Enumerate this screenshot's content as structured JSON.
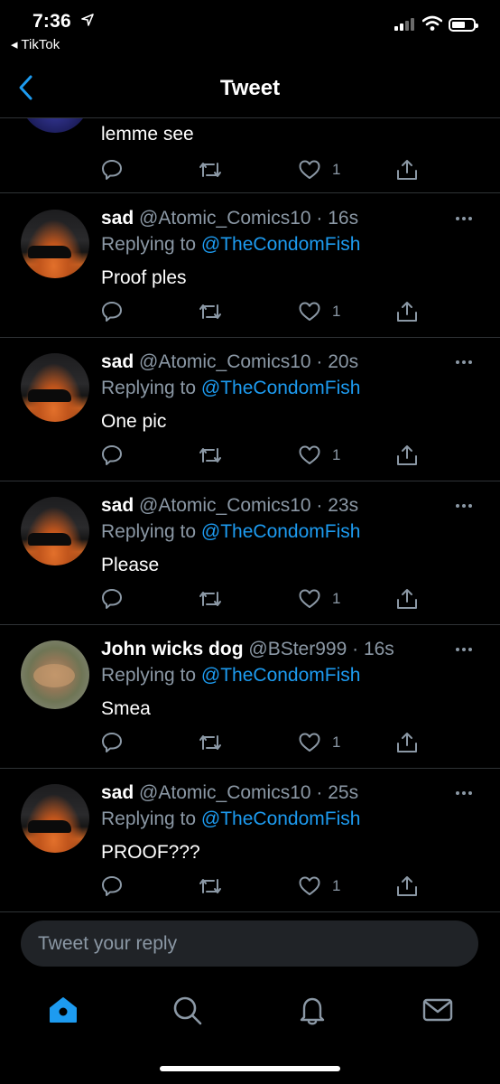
{
  "status_bar": {
    "time": "7:36",
    "back_app": "◂ TikTok"
  },
  "header": {
    "title": "Tweet"
  },
  "partial_tweet": {
    "text": "lemme see",
    "likes": "1"
  },
  "tweets": [
    {
      "name": "sad",
      "handle": "@Atomic_Comics10",
      "sep": " · ",
      "age": "16s",
      "replying_label": "Replying to ",
      "replying_to": "@TheCondomFish",
      "text": "Proof ples",
      "likes": "1"
    },
    {
      "name": "sad",
      "handle": "@Atomic_Comics10",
      "sep": " · ",
      "age": "20s",
      "replying_label": "Replying to ",
      "replying_to": "@TheCondomFish",
      "text": "One pic",
      "likes": "1"
    },
    {
      "name": "sad",
      "handle": "@Atomic_Comics10",
      "sep": " · ",
      "age": "23s",
      "replying_label": "Replying to ",
      "replying_to": "@TheCondomFish",
      "text": "Please",
      "likes": "1"
    },
    {
      "name": "John wicks dog",
      "handle": "@BSter999",
      "sep": " · ",
      "age": "16s",
      "replying_label": "Replying to ",
      "replying_to": "@TheCondomFish",
      "text": "Smea",
      "likes": "1"
    },
    {
      "name": "sad",
      "handle": "@Atomic_Comics10",
      "sep": " · ",
      "age": "25s",
      "replying_label": "Replying to ",
      "replying_to": "@TheCondomFish",
      "text": "PROOF???",
      "likes": "1"
    }
  ],
  "reply_bar": {
    "placeholder": "Tweet your reply"
  },
  "tab_bar": {
    "items": [
      "home-icon",
      "search-icon",
      "bell-icon",
      "mail-icon"
    ]
  },
  "colors": {
    "accent": "#1d9bf0",
    "muted": "#8b98a5",
    "background": "#000000",
    "divider": "#2f3336"
  }
}
